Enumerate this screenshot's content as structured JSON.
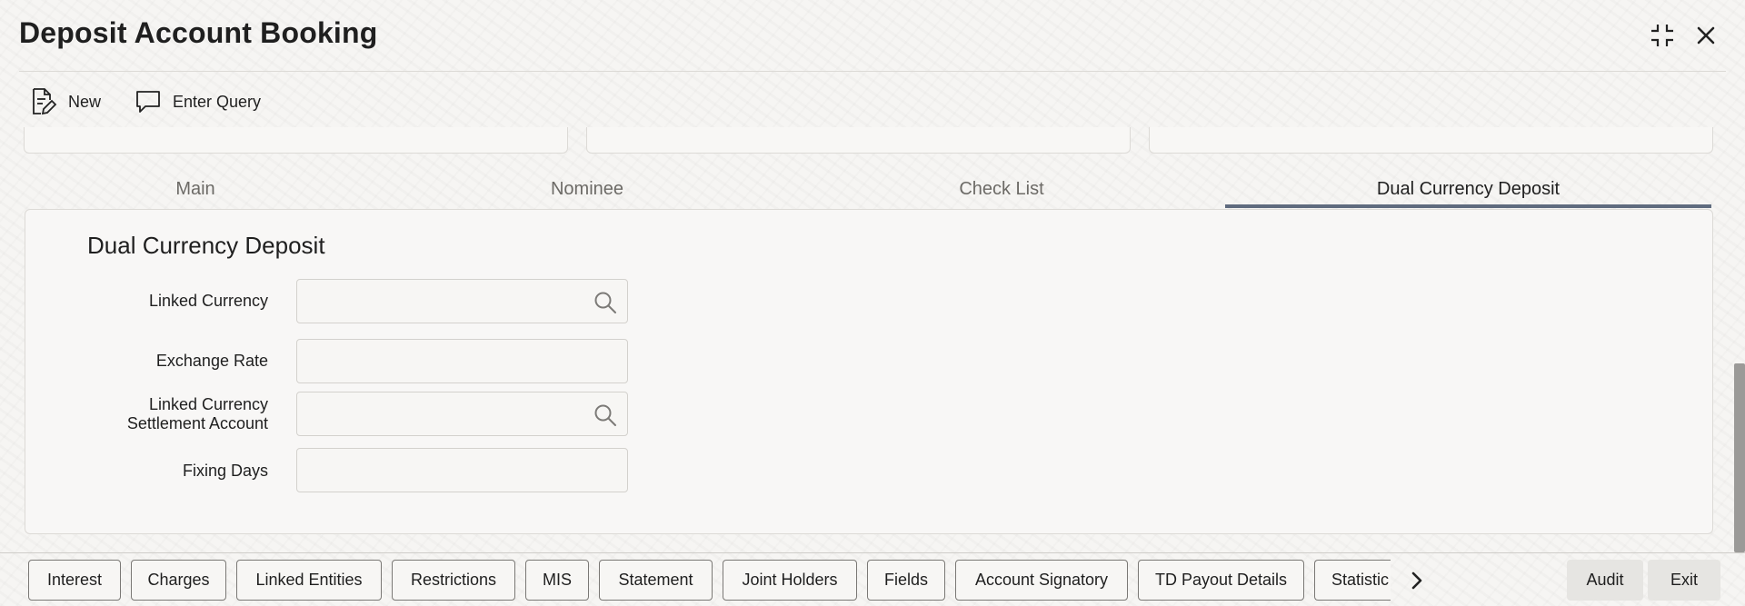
{
  "header": {
    "title": "Deposit Account Booking"
  },
  "toolbar": {
    "new_label": "New",
    "enter_query_label": "Enter Query"
  },
  "tabs": [
    {
      "label": "Main"
    },
    {
      "label": "Nominee"
    },
    {
      "label": "Check List"
    },
    {
      "label": "Dual Currency Deposit",
      "active": true
    }
  ],
  "section": {
    "title": "Dual Currency Deposit",
    "fields": {
      "linked_currency": {
        "label": "Linked Currency",
        "value": ""
      },
      "exchange_rate": {
        "label": "Exchange Rate",
        "value": ""
      },
      "linked_currency_settlement_account": {
        "label_line1": "Linked Currency",
        "label_line2": "Settlement Account",
        "value": ""
      },
      "fixing_days": {
        "label": "Fixing Days",
        "value": ""
      }
    }
  },
  "bottom_buttons": [
    {
      "label": "Interest"
    },
    {
      "label": "Charges"
    },
    {
      "label": "Linked Entities"
    },
    {
      "label": "Restrictions"
    },
    {
      "label": "MIS"
    },
    {
      "label": "Statement"
    },
    {
      "label": "Joint Holders"
    },
    {
      "label": "Fields"
    },
    {
      "label": "Account Signatory"
    },
    {
      "label": "TD Payout Details"
    },
    {
      "label": "Statistic"
    }
  ],
  "footer": {
    "audit_label": "Audit",
    "exit_label": "Exit"
  },
  "colors": {
    "accent_tab_underline": "#5f6b7e",
    "text": "#1f1f1f",
    "inactive_tab": "#6c6a66",
    "border": "#dcdad6"
  },
  "icons": [
    "new-document-icon",
    "enter-query-icon",
    "minimize-icon",
    "close-icon",
    "search-icon",
    "chevron-right-icon"
  ]
}
